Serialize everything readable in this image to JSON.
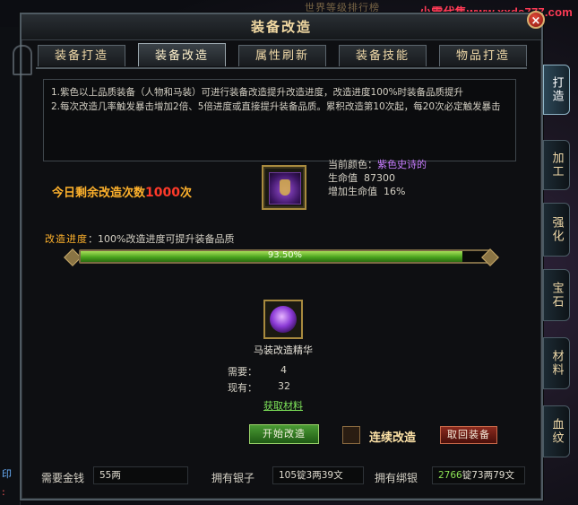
{
  "overlay": {
    "watermark": "小雪代售www.xxds777.com",
    "banner_text": "世界等级排行榜"
  },
  "window": {
    "title": "装备改造",
    "close_label": "×"
  },
  "tabs": [
    {
      "label": "装备打造",
      "active": false
    },
    {
      "label": "装备改造",
      "active": true
    },
    {
      "label": "属性刷新",
      "active": false
    },
    {
      "label": "装备技能",
      "active": false
    },
    {
      "label": "物品打造",
      "active": false
    }
  ],
  "description": {
    "line1": "1.紫色以上品质装备（人物和马装）可进行装备改造提升改造进度，改造进度100%时装备品质提升",
    "line2": "2.每次改造几率触发暴击增加2倍、5倍进度或直接提升装备品质。累积改造第10次起，每20次必定触发暴击"
  },
  "remaining": {
    "label": "今日剩余改造次数",
    "count": "1000",
    "unit": "次"
  },
  "equipment": {
    "icon": "purple-mount-armor-icon",
    "color_label": "当前颜色：",
    "color_value": "紫色史诗的",
    "hp_label": "生命值",
    "hp_value": "87300",
    "hp_bonus_label": "增加生命值",
    "hp_bonus_value": "16%"
  },
  "progress": {
    "key": "改造进度",
    "hint": "：100%改造进度可提升装备品质",
    "percent": 93.5,
    "text": "93.50%"
  },
  "material": {
    "icon": "purple-essence-orb-icon",
    "name": "马装改造精华",
    "need_label": "需要：",
    "need_value": "4",
    "have_label": "现有：",
    "have_value": "32",
    "get_link": "获取材料"
  },
  "actions": {
    "start": "开始改造",
    "continuous": "连续改造",
    "retrieve": "取回装备"
  },
  "footer": {
    "gold_label": "需要金钱",
    "gold_value": "55两",
    "silver_label": "拥有银子",
    "silver_value": "105锭3两39文",
    "bound_label": "拥有绑银",
    "bound_value_highlight": "2766",
    "bound_value_rest": "锭73两79文"
  },
  "side_tabs": [
    {
      "label": "打造",
      "active": true
    },
    {
      "label": "加工",
      "active": false
    },
    {
      "label": "强化",
      "active": false
    },
    {
      "label": "宝石",
      "active": false
    },
    {
      "label": "材料",
      "active": false
    },
    {
      "label": "血纹",
      "active": false
    }
  ],
  "colors": {
    "accent_gold": "#ffb22c",
    "crit_red": "#ff3a2a",
    "epic_purple": "#c87dff",
    "progress_green": "#4aa41e"
  }
}
